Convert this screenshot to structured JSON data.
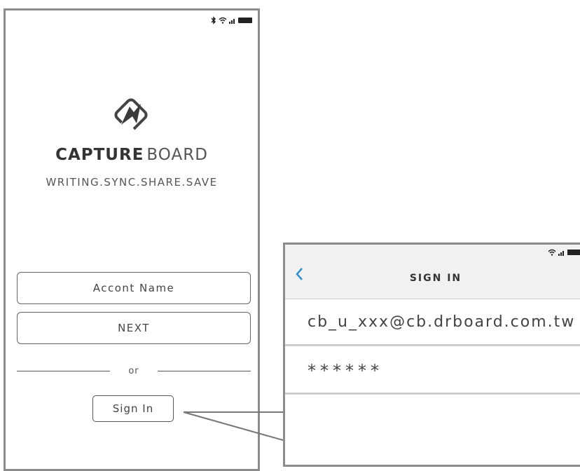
{
  "login_screen": {
    "brand_bold": "CAPTURE",
    "brand_light": "BOARD",
    "tagline": "WRITING.SYNC.SHARE.SAVE",
    "account_field": "Accont Name",
    "next_button": "NEXT",
    "or_label": "or",
    "sign_in_button": "Sign In"
  },
  "sign_in_panel": {
    "title": "SIGN IN",
    "email_value": "cb_u_xxx@cb.drboard.com.tw",
    "password_value": "******"
  },
  "colors": {
    "back_arrow": "#2f8fd0",
    "frame": "#8c8c8c"
  },
  "icons": [
    "bluetooth-icon",
    "wifi-icon",
    "signal-icon",
    "battery-icon",
    "capture-board-logo-icon",
    "back-chevron-icon"
  ]
}
